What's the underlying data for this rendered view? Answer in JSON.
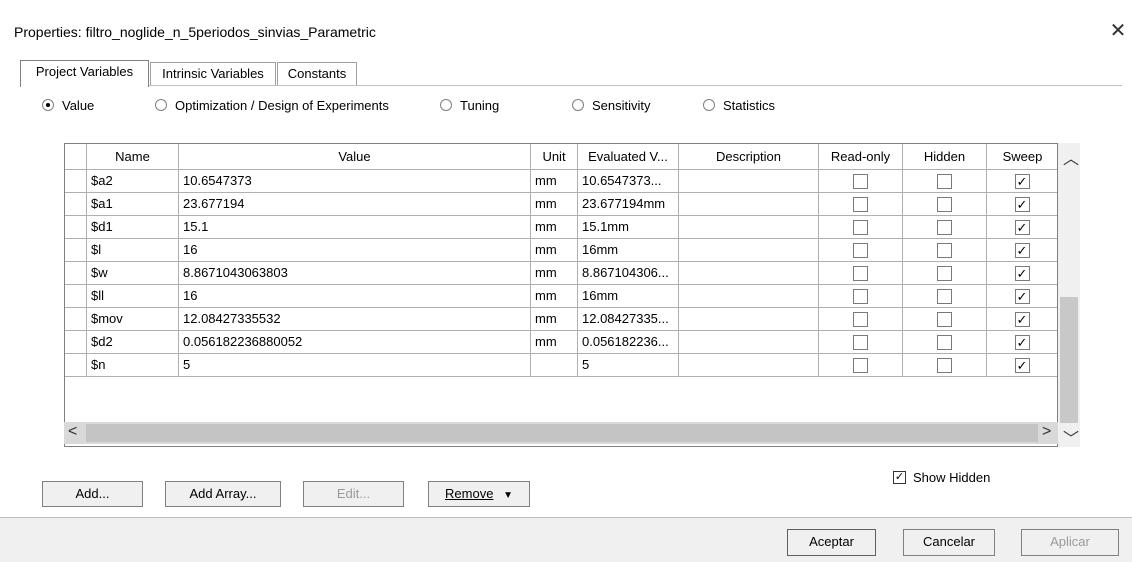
{
  "window": {
    "title": "Properties: filtro_noglide_n_5periodos_sinvias_Parametric"
  },
  "tabs": [
    "Project Variables",
    "Intrinsic Variables",
    "Constants"
  ],
  "modes": [
    {
      "label": "Value",
      "selected": true
    },
    {
      "label": "Optimization / Design of Experiments",
      "selected": false
    },
    {
      "label": "Tuning",
      "selected": false
    },
    {
      "label": "Sensitivity",
      "selected": false
    },
    {
      "label": "Statistics",
      "selected": false
    }
  ],
  "table": {
    "columns": [
      "Name",
      "Value",
      "Unit",
      "Evaluated V...",
      "Description",
      "Read-only",
      "Hidden",
      "Sweep"
    ],
    "rows": [
      {
        "name": "$a2",
        "value": "10.6547373",
        "unit": "mm",
        "evaluated": "10.6547373...",
        "description": "",
        "read_only": false,
        "hidden": false,
        "sweep": true
      },
      {
        "name": "$a1",
        "value": "23.677194",
        "unit": "mm",
        "evaluated": "23.677194mm",
        "description": "",
        "read_only": false,
        "hidden": false,
        "sweep": true
      },
      {
        "name": "$d1",
        "value": "15.1",
        "unit": "mm",
        "evaluated": "15.1mm",
        "description": "",
        "read_only": false,
        "hidden": false,
        "sweep": true
      },
      {
        "name": "$l",
        "value": "16",
        "unit": "mm",
        "evaluated": "16mm",
        "description": "",
        "read_only": false,
        "hidden": false,
        "sweep": true
      },
      {
        "name": "$w",
        "value": "8.8671043063803",
        "unit": "mm",
        "evaluated": "8.867104306...",
        "description": "",
        "read_only": false,
        "hidden": false,
        "sweep": true
      },
      {
        "name": "$ll",
        "value": "16",
        "unit": "mm",
        "evaluated": "16mm",
        "description": "",
        "read_only": false,
        "hidden": false,
        "sweep": true
      },
      {
        "name": "$mov",
        "value": "12.08427335532",
        "unit": "mm",
        "evaluated": "12.08427335...",
        "description": "",
        "read_only": false,
        "hidden": false,
        "sweep": true
      },
      {
        "name": "$d2",
        "value": "0.056182236880052",
        "unit": "mm",
        "evaluated": "0.056182236...",
        "description": "",
        "read_only": false,
        "hidden": false,
        "sweep": true
      },
      {
        "name": "$n",
        "value": "5",
        "unit": "",
        "evaluated": "5",
        "description": "",
        "read_only": false,
        "hidden": false,
        "sweep": true
      }
    ]
  },
  "show_hidden": {
    "label": "Show Hidden",
    "checked": true
  },
  "actions": {
    "add": "Add...",
    "add_array": "Add Array...",
    "edit": "Edit...",
    "remove": "Remove"
  },
  "footer": {
    "ok": "Aceptar",
    "cancel": "Cancelar",
    "apply": "Aplicar"
  },
  "icons": {
    "close": "close-icon",
    "dropdown": "caret-down-icon",
    "scroll_up": "chevron-up-icon",
    "scroll_down": "chevron-down-icon",
    "scroll_left": "chevron-left-icon",
    "scroll_right": "chevron-right-icon"
  }
}
